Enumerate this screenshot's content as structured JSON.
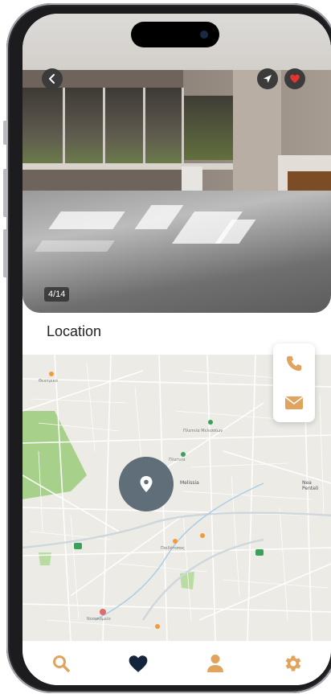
{
  "photo": {
    "counter": "4/14",
    "back_icon": "chevron-left-icon",
    "share_icon": "navigation-arrow-icon",
    "favorite_icon": "heart-icon"
  },
  "location": {
    "title": "Location"
  },
  "map": {
    "labels": {
      "melissia": "Melissia",
      "nea_penteli": "Nea Penteli"
    },
    "contact": {
      "phone_icon": "phone-icon",
      "email_icon": "envelope-icon"
    },
    "pin_icon": "location-pin-icon"
  },
  "tabbar": {
    "items": [
      {
        "icon": "search-icon"
      },
      {
        "icon": "heart-icon"
      },
      {
        "icon": "user-icon"
      },
      {
        "icon": "gear-icon"
      }
    ]
  },
  "colors": {
    "accent": "#e0a45e",
    "dark_navy": "#14243a",
    "pin": "#5f6e78"
  }
}
